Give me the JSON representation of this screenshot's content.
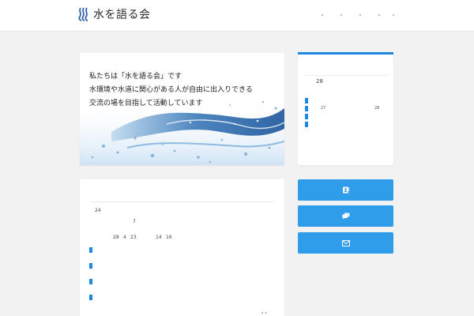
{
  "header": {
    "site_title": "水を語る会",
    "logo_icon": "water-waves-logo-icon",
    "nav_item_count": 5
  },
  "hero": {
    "lines": [
      "私たちは「水を語る会」です",
      "水環境や水道に関心がある人が自由に出入りできる",
      "交流の場を目指して活動しています"
    ]
  },
  "sidebar": {
    "widget": {
      "number_top": "28",
      "number_left": "27",
      "number_right": "28"
    },
    "buttons": [
      {
        "icon": "contact-icon"
      },
      {
        "icon": "chat-icon"
      },
      {
        "icon": "mail-icon"
      }
    ]
  },
  "main": {
    "top_number": "24",
    "mid_number": "7",
    "numbers_row_a": "28",
    "numbers_row_b": "4",
    "numbers_row_c": "23",
    "numbers_row_d": "14",
    "numbers_row_e": "16",
    "pager": "› ›"
  },
  "colors": {
    "accent": "#2f9de9",
    "accent_dark": "#1e88e5",
    "background": "#f2f2f2"
  }
}
